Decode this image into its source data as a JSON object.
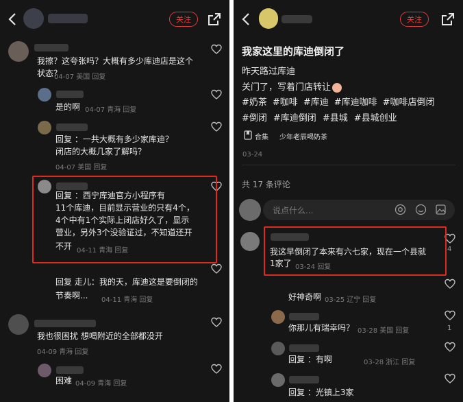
{
  "left": {
    "follow": "关注",
    "comments": [
      {
        "text": [
          "我擦？这夸张吗？大概有多少库迪店是这个",
          "状态？"
        ],
        "meta": "04-07 美国 回复"
      },
      {
        "text": [
          "是的啊"
        ],
        "meta": "04-07 青海 回复"
      },
      {
        "text": [
          "回复 ：一共大概有多少家库迪？",
          "闭店的大概几家了解吗？"
        ],
        "meta": "04-07 美国 回复"
      },
      {
        "text": [
          "回复 ：西宁库迪官方小程序有",
          "11个库迪，目前显示营业的只有4个，",
          "4个中有1个实际上闭店好久了，显示",
          "营业，另外3个没验证过，不知道还开",
          "不开"
        ],
        "meta": "04-11 青海 回复"
      },
      {
        "text": [
          "回复 走儿：我的天，库迪这是要倒闭的",
          "节奏啊..."
        ],
        "meta": "04-11 青海 回复"
      },
      {
        "text": [
          "我也很困扰 想喝附近的全部都没开"
        ],
        "meta": "04-09 青海 回复"
      },
      {
        "text": [
          "困难"
        ],
        "meta": "04-09 青海 回复"
      }
    ]
  },
  "right": {
    "follow": "关注",
    "post_title": "我家这里的库迪倒闭了",
    "post_lines": [
      "昨天路过库迪",
      "关门了，写着门店转让"
    ],
    "hashtags_line1": [
      "#奶茶",
      "#咖啡",
      "#库迪",
      "#库迪咖啡",
      "#咖啡店倒闭"
    ],
    "hashtags_line2": [
      "#倒闭",
      "#库迪倒闭",
      "#县城",
      "#县城创业"
    ],
    "collection_label": "合集",
    "collection_name": "少年老辰喝奶茶",
    "post_date": "03-24",
    "comment_count_label": "共 17 条评论",
    "input_placeholder": "说点什么...",
    "comments": [
      {
        "text": [
          "我这早倒闭了本来有六七家，现在一个县就",
          "1家了"
        ],
        "meta": "03-24 回复",
        "likes": "4"
      },
      {
        "text": [
          "好神奇啊"
        ],
        "meta": "03-25 辽宁 回复"
      },
      {
        "text": [
          "你那儿有瑞幸吗？"
        ],
        "meta": "03-28 美国 回复",
        "likes": "1"
      },
      {
        "text": [
          "回复 ：有啊"
        ],
        "meta": "03-28 浙江 回复"
      },
      {
        "text": [
          "回复 ：光镇上3家"
        ],
        "meta": ""
      }
    ]
  },
  "colors": {
    "accent_red": "#e5393b",
    "highlight_box": "#e02a1e",
    "background": "#161616"
  },
  "icons": [
    "back-arrow-icon",
    "share-icon",
    "heart-icon",
    "at-icon",
    "emoji-icon",
    "image-icon",
    "collection-icon"
  ]
}
